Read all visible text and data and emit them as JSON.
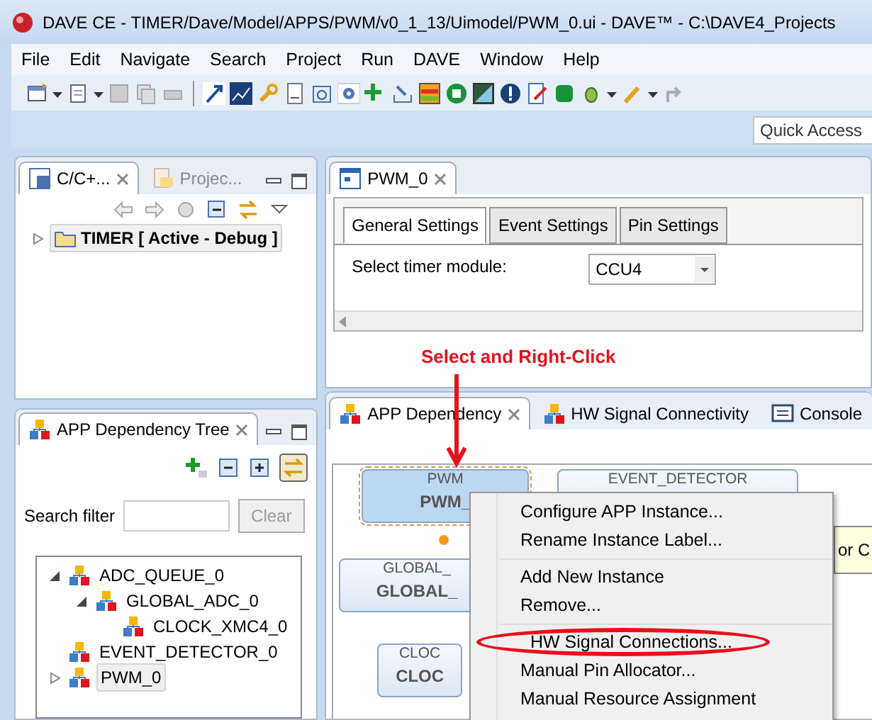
{
  "window": {
    "title": "DAVE CE - TIMER/Dave/Model/APPS/PWM/v0_1_13/Uimodel/PWM_0.ui - DAVE™ - C:\\DAVE4_Projects"
  },
  "menu": [
    "File",
    "Edit",
    "Navigate",
    "Search",
    "Project",
    "Run",
    "DAVE",
    "Window",
    "Help"
  ],
  "quick_access": {
    "placeholder": "Quick Access"
  },
  "project_panel": {
    "tabs": [
      {
        "label": "C/C+...",
        "selected": true
      },
      {
        "label": "Projec...",
        "selected": false
      }
    ],
    "tree": [
      {
        "label": "TIMER [ Active - Debug ]",
        "expanded": false,
        "selected": true
      }
    ]
  },
  "editor": {
    "tabs": [
      {
        "label": "PWM_0",
        "selected": true
      }
    ],
    "settings_tabs": [
      {
        "label": "General Settings",
        "selected": true
      },
      {
        "label": "Event Settings",
        "selected": false
      },
      {
        "label": "Pin Settings",
        "selected": false
      }
    ],
    "field": {
      "label": "Select timer module:",
      "value": "CCU4"
    }
  },
  "dependency_tree": {
    "title": "APP Dependency Tree",
    "search_label": "Search filter",
    "clear_button": {
      "label": "Clear",
      "disabled": true
    },
    "tree": [
      {
        "label": "ADC_QUEUE_0",
        "expanded": true,
        "selected": false,
        "children": [
          {
            "label": "GLOBAL_ADC_0",
            "expanded": true,
            "selected": false,
            "children": [
              {
                "label": "CLOCK_XMC4_0",
                "selected": false
              }
            ]
          }
        ]
      },
      {
        "label": "EVENT_DETECTOR_0",
        "selected": false
      },
      {
        "label": "PWM_0",
        "expanded": false,
        "selected": true
      }
    ]
  },
  "bottom_tabs": [
    {
      "label": "APP Dependency",
      "selected": true,
      "kind": "app"
    },
    {
      "label": "HW Signal Connectivity",
      "selected": false,
      "kind": "app"
    },
    {
      "label": "Console",
      "selected": false,
      "kind": "console"
    }
  ],
  "diagram": {
    "nodes": [
      {
        "title": "PWM",
        "name": "PWM_",
        "selected": true
      },
      {
        "title": "EVENT_DETECTOR",
        "selected": false
      },
      {
        "title": "GLOBAL_",
        "name": "GLOBAL_",
        "selected": false
      },
      {
        "title": "CLOC",
        "name": "CLOC",
        "selected": false
      }
    ],
    "tooltip": "or C"
  },
  "context_menu": [
    {
      "kind": "item",
      "label": "Configure APP Instance..."
    },
    {
      "kind": "item",
      "label": "Rename Instance Label..."
    },
    {
      "kind": "separator"
    },
    {
      "kind": "item",
      "label": "Add New Instance"
    },
    {
      "kind": "item",
      "label": "Remove..."
    },
    {
      "kind": "separator"
    },
    {
      "kind": "item",
      "label": "HW Signal Connections...",
      "circled": true
    },
    {
      "kind": "item",
      "label": "Manual Pin Allocator..."
    },
    {
      "kind": "item",
      "label": "Manual Resource Assignment"
    }
  ],
  "annotation": {
    "text": "Select and Right-Click"
  }
}
